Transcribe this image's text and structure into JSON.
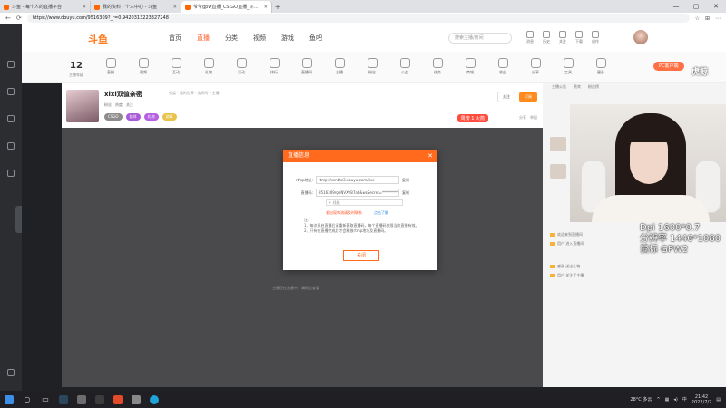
{
  "browser": {
    "tabs": [
      {
        "title": "斗鱼 - 每个人的直播平台",
        "active": false
      },
      {
        "title": "我的资料 - 个人中心 - 斗鱼",
        "active": false
      },
      {
        "title": "爷爷gpw直播_CS:GO直播_斗鱼直播",
        "active": true
      }
    ],
    "new_tab": "+",
    "url": "https://www.douyu.com/9516309?_r=0.9420313223327248"
  },
  "header": {
    "logo": "斗鱼",
    "nav": [
      "首页",
      "直播",
      "分类",
      "视频",
      "游戏",
      "鱼吧"
    ],
    "search_placeholder": "搜索主播/房间",
    "icons": [
      "消息",
      "历史",
      "关注",
      "下载",
      "创作"
    ]
  },
  "featbar": {
    "level": "12",
    "level_label": "主播等级",
    "features": [
      "直播",
      "视频",
      "互动",
      "礼物",
      "活动",
      "排行",
      "直播间",
      "主播",
      "粉丝",
      "公会",
      "任务",
      "商城",
      "收益",
      "分享",
      "工具",
      "更多"
    ],
    "pc_button": "PC客户端"
  },
  "room": {
    "name": "xixi双值亲密",
    "meta": "分类 · 我的世界 · 房间号 · 主播",
    "stats": [
      "粉丝",
      "热度",
      "关注"
    ],
    "tags": [
      "CSGO",
      "陪伴",
      "礼物",
      "勋章"
    ],
    "follow_label": "关注",
    "subscribe_label": "订阅",
    "rank_label": "周榜 1 火箭",
    "tools": [
      "分享",
      "举报"
    ]
  },
  "chat": {
    "top": [
      "主播公告",
      "贵宾",
      "粉丝榜"
    ],
    "lines": [
      "欢迎来到直播间",
      "用户 进入直播间",
      "感谢 送出礼物",
      "用户 关注了主播"
    ]
  },
  "video_note": "主播正在准备中，请稍后查看",
  "modal": {
    "title": "直播信息",
    "rtmp_label": "rtmp地址:",
    "rtmp_value": "rtmp://sendtc3.douyu.com/live",
    "code_label": "直播码:",
    "code_value": "9516309rgeNVXY87ad&wsSecret=***************",
    "copy_label": "复制",
    "select_value": "+ 线路",
    "warn": "若出现串流请及时联系",
    "link": "点击了解",
    "notes": [
      "注:",
      "1、每次开启直播后请重新获取直播码，每个直播码仅限当次直播有效。",
      "2、只有在直播完成后才会释放rtmp地址及直播码。"
    ],
    "ok_label": "关闭"
  },
  "osd": {
    "line1": "Dpi 1600*0.7",
    "line2": "分辨率 1440*1080",
    "line3": "鼠标 GPW2",
    "brand": "虎鲸"
  },
  "taskbar": {
    "weather": "28°C 多云",
    "lang": "中",
    "time": "21:42",
    "date": "2022/7/7"
  }
}
